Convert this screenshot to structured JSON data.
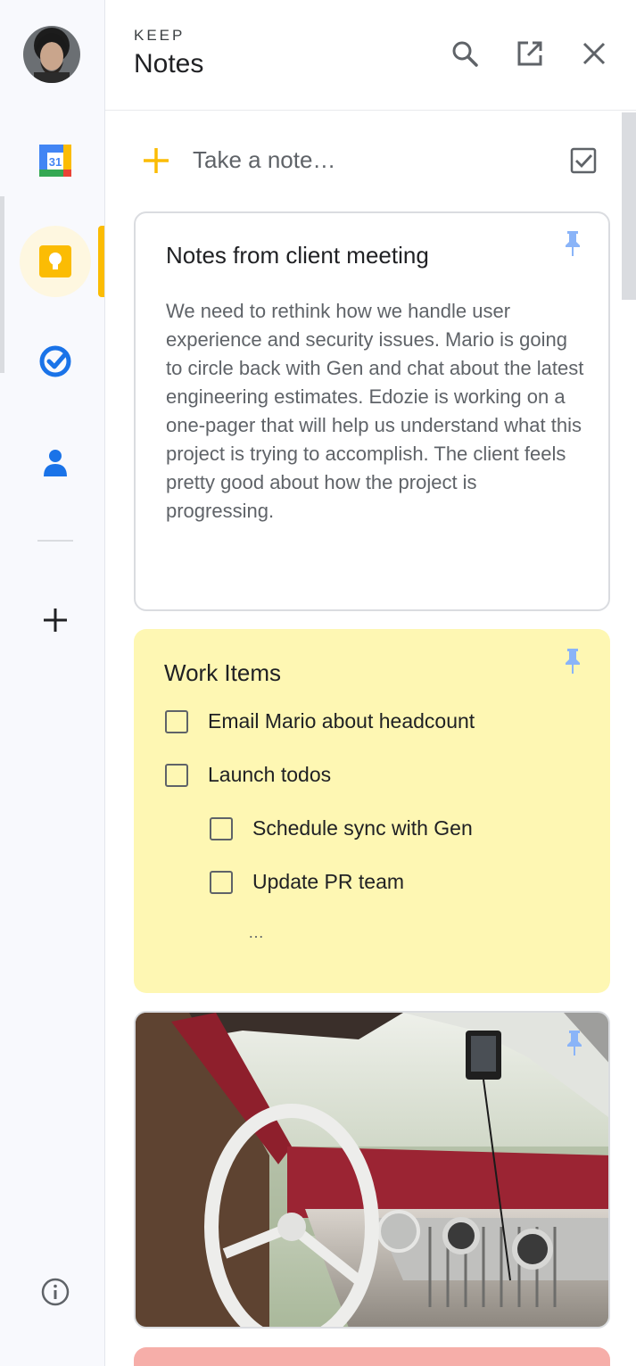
{
  "header": {
    "kicker": "KEEP",
    "title": "Notes"
  },
  "rail": {
    "items": [
      {
        "name": "calendar",
        "label": "31",
        "icon": "calendar-icon"
      },
      {
        "name": "keep",
        "icon": "keep-bulb-icon",
        "active": true
      },
      {
        "name": "tasks",
        "icon": "tasks-check-icon"
      },
      {
        "name": "contacts",
        "icon": "contacts-person-icon"
      },
      {
        "name": "add",
        "icon": "plus-icon"
      },
      {
        "name": "info",
        "icon": "info-icon"
      }
    ]
  },
  "composer": {
    "placeholder": "Take a note…"
  },
  "notes": [
    {
      "title": "Notes from client meeting",
      "body": "We need to rethink how we handle user experience and security issues. Mario is going to circle back with Gen and chat about the latest engineering estimates. Edozie is working on a one-pager that will help us understand what this project is trying to accomplish. The client feels pretty good about how the project is progressing.",
      "color": "#ffffff",
      "pinned": true
    },
    {
      "title": "Work Items",
      "color": "#fef7b3",
      "pinned": true,
      "items": [
        {
          "text": "Email Mario about headcount",
          "checked": false,
          "level": 0
        },
        {
          "text": "Launch todos",
          "checked": false,
          "level": 0
        },
        {
          "text": "Schedule sync with Gen",
          "checked": false,
          "level": 1
        },
        {
          "text": "Update PR team",
          "checked": false,
          "level": 1
        }
      ],
      "more": "…"
    },
    {
      "image": "vintage-car-dashboard",
      "pinned": true
    },
    {
      "color": "#f6aea9"
    }
  ],
  "colors": {
    "accent": "#fbbc04",
    "pin": "#8ab4f8"
  }
}
